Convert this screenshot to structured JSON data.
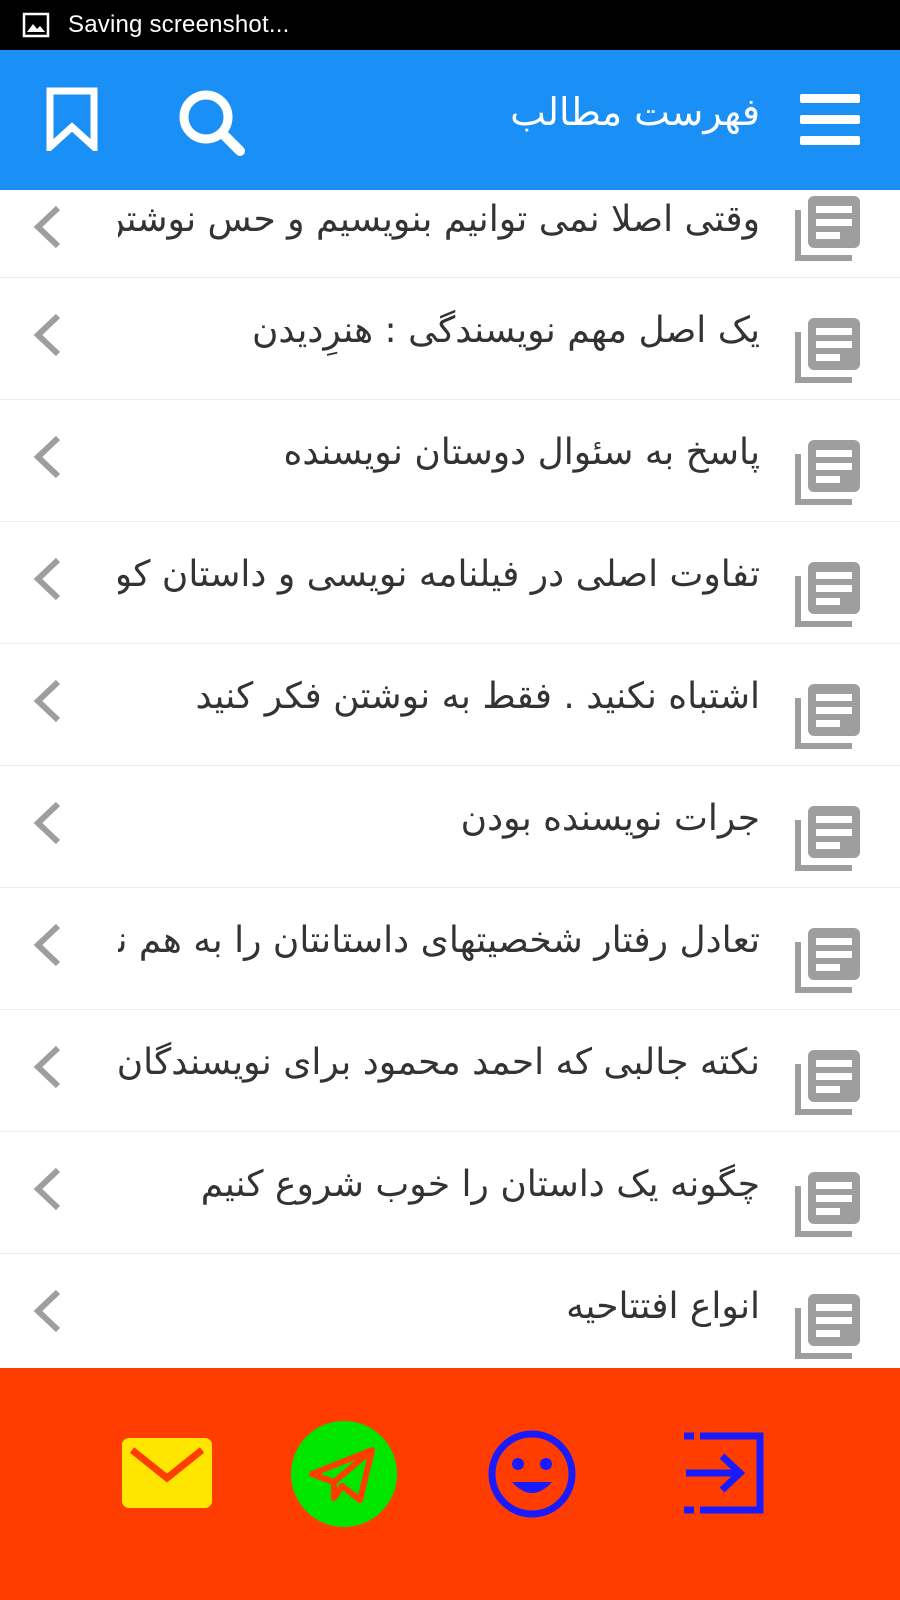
{
  "status_bar": {
    "text": "Saving screenshot..."
  },
  "app_bar": {
    "title": "فهرست مطالب",
    "icons": {
      "menu": "menu-icon",
      "search": "search-icon",
      "bookmark": "bookmark-icon"
    }
  },
  "list": {
    "items": [
      {
        "label": "وقتی اصلا نمی توانیم بنویسیم و حس نوشتن نداریم"
      },
      {
        "label": "یک اصل مهم نویسندگی : هنرِدیدن"
      },
      {
        "label": "پاسخ به سئوال دوستان نویسنده"
      },
      {
        "label": "تفاوت اصلی در فیلنامه نویسی و داستان کوتاه"
      },
      {
        "label": "اشتباه نکنید . فقط به نوشتن فکر کنید"
      },
      {
        "label": "جرات نویسنده بودن"
      },
      {
        "label": "تعادل رفتار شخصیتهای داستانتان را به هم نزنید"
      },
      {
        "label": "نکته جالبی که احمد محمود برای نویسندگان گفت"
      },
      {
        "label": "چگونه یک داستان را خوب شروع کنیم"
      },
      {
        "label": "انواع افتتاحیه"
      }
    ]
  },
  "bottom_bar": {
    "icons": [
      "mail-icon",
      "telegram-icon",
      "smile-icon",
      "login-icon"
    ]
  },
  "colors": {
    "status_bar": "#000000",
    "app_bar": "#1a8ff5",
    "bottom_bar": "#ff3d00",
    "mail": "#ffe600",
    "telegram": "#00e600",
    "smile": "#1a1aff",
    "login": "#1a1aff"
  }
}
